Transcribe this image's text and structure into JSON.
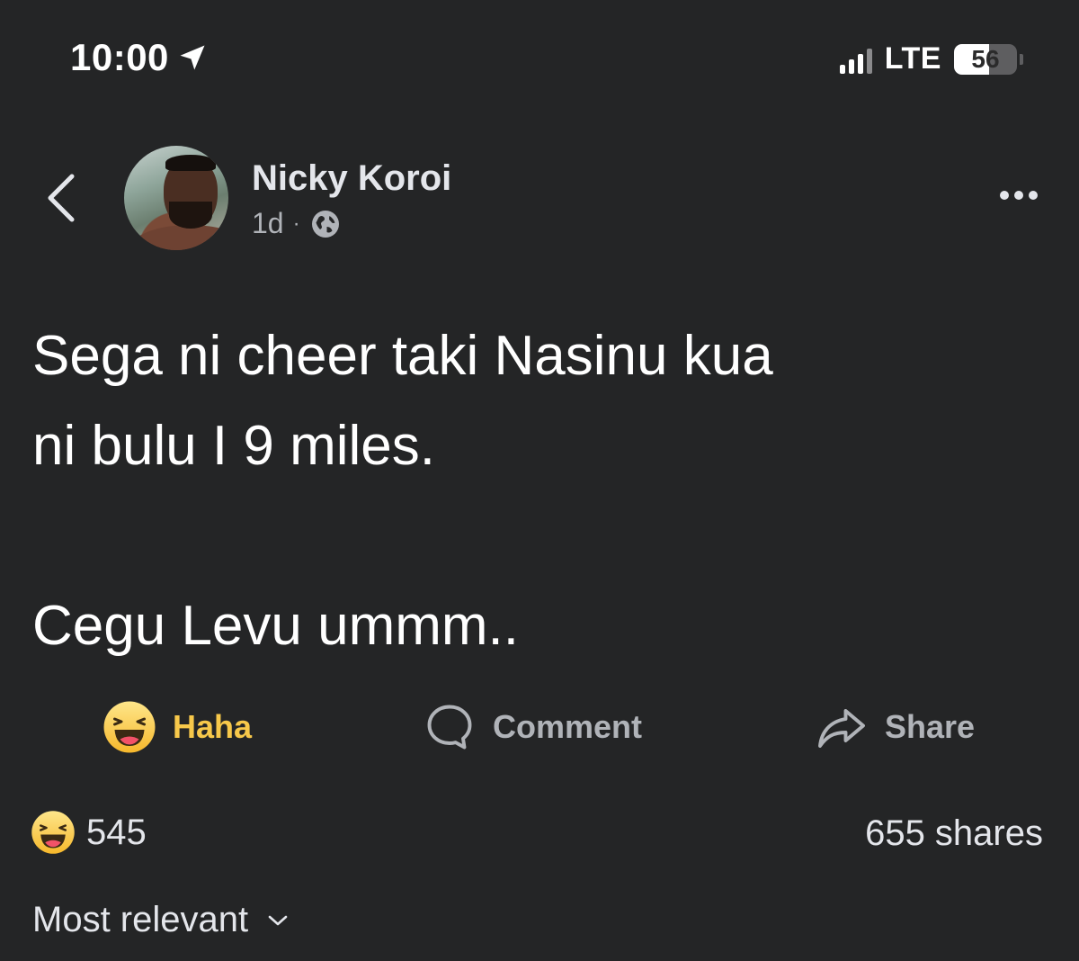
{
  "status_bar": {
    "time": "10:00",
    "network": "LTE",
    "battery_level": "56",
    "battery_fraction": 0.56
  },
  "post": {
    "author": "Nicky Koroi",
    "age": "1d",
    "separator": "·",
    "audience_icon": "globe-icon",
    "text": "Sega ni cheer taki Nasinu kua\nni bulu I 9 miles.\n\nCegu Levu ummm.."
  },
  "actions": {
    "haha_label": "Haha",
    "comment_label": "Comment",
    "share_label": "Share"
  },
  "counts": {
    "reactions": "545",
    "shares": "655 shares"
  },
  "sort": {
    "label": "Most relevant"
  },
  "colors": {
    "background": "#242526",
    "text_primary": "#e4e6eb",
    "text_secondary": "#b0b3b8",
    "haha_accent": "#f7c84a"
  }
}
